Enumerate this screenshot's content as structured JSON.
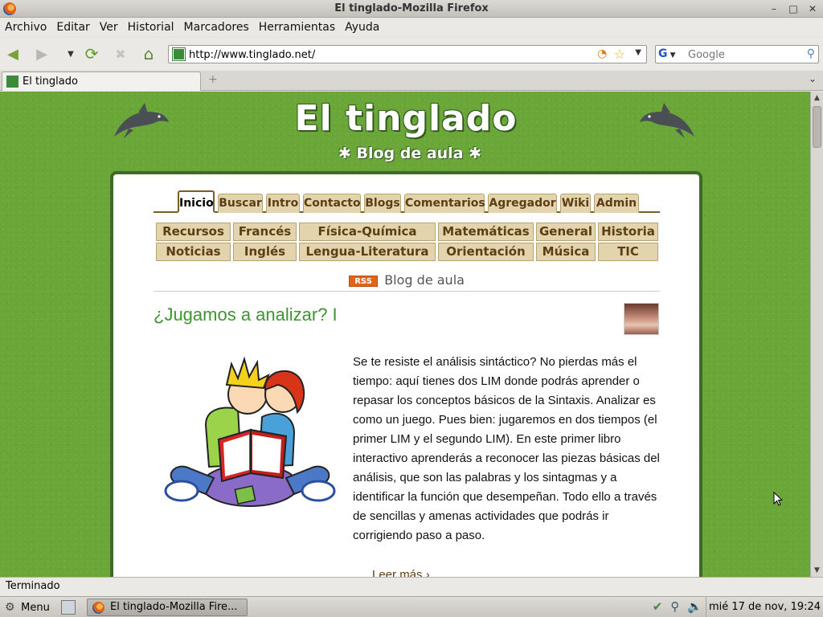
{
  "window": {
    "title": "El tinglado-Mozilla Firefox"
  },
  "menubar": {
    "items": [
      "Archivo",
      "Editar",
      "Ver",
      "Historial",
      "Marcadores",
      "Herramientas",
      "Ayuda"
    ]
  },
  "navbar": {
    "url": "http://www.tinglado.net/",
    "search_placeholder": "Google",
    "search_engine": "G"
  },
  "tabs": [
    {
      "label": "El tinglado",
      "active": true
    }
  ],
  "site": {
    "title": "El tinglado",
    "subtitle": "✱ Blog de aula ✱"
  },
  "main_nav": [
    "Inicio",
    "Buscar",
    "Intro",
    "Contacto",
    "Blogs",
    "Comentarios",
    "Agregador",
    "Wiki",
    "Admin"
  ],
  "categories": {
    "row1": [
      "Recursos",
      "Francés",
      "Física-Química",
      "Matemáticas",
      "General",
      "Historia"
    ],
    "row2": [
      "Noticias",
      "Inglés",
      "Lengua-Literatura",
      "Orientación",
      "Música",
      "TIC"
    ]
  },
  "blog_header": {
    "rss": "RSS",
    "label": "Blog de aula"
  },
  "post": {
    "title": "¿Jugamos a analizar? I",
    "body": "Se te resiste el análisis sintáctico? No pierdas más el tiempo: aquí tienes dos LIM donde podrás aprender o repasar los conceptos básicos de la Sintaxis. Analizar es como un juego. Pues bien: jugaremos en dos tiempos (el primer LIM y el segundo LIM). En este primer libro interactivo aprenderás a reconocer las piezas básicas del análisis, que son las palabras y los sintagmas y a identificar la función que desempeñan. Todo ello a través de sencillas y amenas actividades que podrás ir corrigiendo paso a paso.",
    "read_more": "Leer más"
  },
  "statusbar": {
    "text": "Terminado"
  },
  "taskbar": {
    "menu_label": "Menu",
    "window_button": "El tinglado-Mozilla Fire...",
    "clock": "mié 17 de nov, 19:24"
  },
  "colors": {
    "page_green": "#6aa638",
    "panel_border": "#3e6a24",
    "tab_bg": "#e4d4ad",
    "tab_text": "#5b3e14",
    "post_title": "#3d9530"
  }
}
